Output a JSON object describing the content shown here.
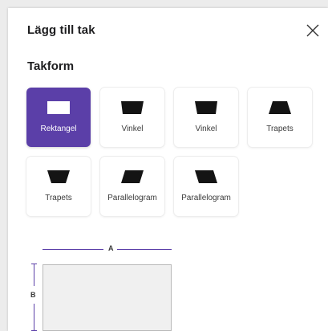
{
  "dialog": {
    "title": "Lägg till tak",
    "close_icon": "close-icon",
    "section_title": "Takform"
  },
  "shapes": [
    {
      "label": "Rektangel",
      "icon": "rectangle-icon",
      "selected": true
    },
    {
      "label": "Vinkel",
      "icon": "angle-right-icon",
      "selected": false
    },
    {
      "label": "Vinkel",
      "icon": "angle-left-icon",
      "selected": false
    },
    {
      "label": "Trapets",
      "icon": "trapezoid-icon",
      "selected": false
    },
    {
      "label": "Trapets",
      "icon": "inverted-trapezoid-icon",
      "selected": false
    },
    {
      "label": "Parallelogram",
      "icon": "parallelogram-right-icon",
      "selected": false
    },
    {
      "label": "Parallelogram",
      "icon": "parallelogram-left-icon",
      "selected": false
    }
  ],
  "dimensions": {
    "a_label": "A",
    "b_label": "B"
  },
  "colors": {
    "accent": "#5b3fa8",
    "shape_fill": "#141414"
  }
}
